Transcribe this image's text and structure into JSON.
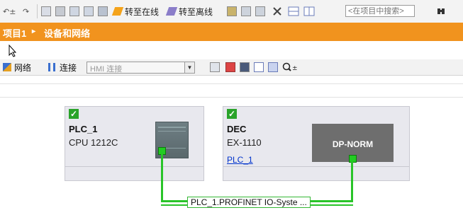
{
  "toolbar": {
    "go_online": "转至在线",
    "go_offline": "转至离线",
    "search_placeholder": "<在项目中搜索>"
  },
  "breadcrumb": {
    "project": "项目1",
    "separator": "▸",
    "page": "设备和网络"
  },
  "network_toolbar": {
    "network_label": "网络",
    "connections_label": "连接",
    "hmi_connection": "HMI 连接"
  },
  "devices": [
    {
      "name": "PLC_1",
      "type": "CPU 1212C"
    },
    {
      "name": "DEC",
      "type": "EX-1110",
      "module_label": "DP-NORM",
      "link_text": "PLC_1"
    }
  ],
  "network": {
    "label": "PLC_1.PROFINET  IO-Syste ..."
  },
  "colors": {
    "accent_orange": "#f1931e",
    "network_green": "#29c429",
    "status_green": "#2aa32a",
    "link_blue": "#0033cc"
  },
  "icons": [
    "undo-icon",
    "compile-icon",
    "download-icon",
    "go-online-icon",
    "go-offline-icon",
    "accessible-devices-icon",
    "cross-reference-icon",
    "split-horizontal-icon",
    "split-vertical-icon",
    "search-project-icon",
    "network-icon",
    "connections-icon",
    "zoom-icon"
  ]
}
